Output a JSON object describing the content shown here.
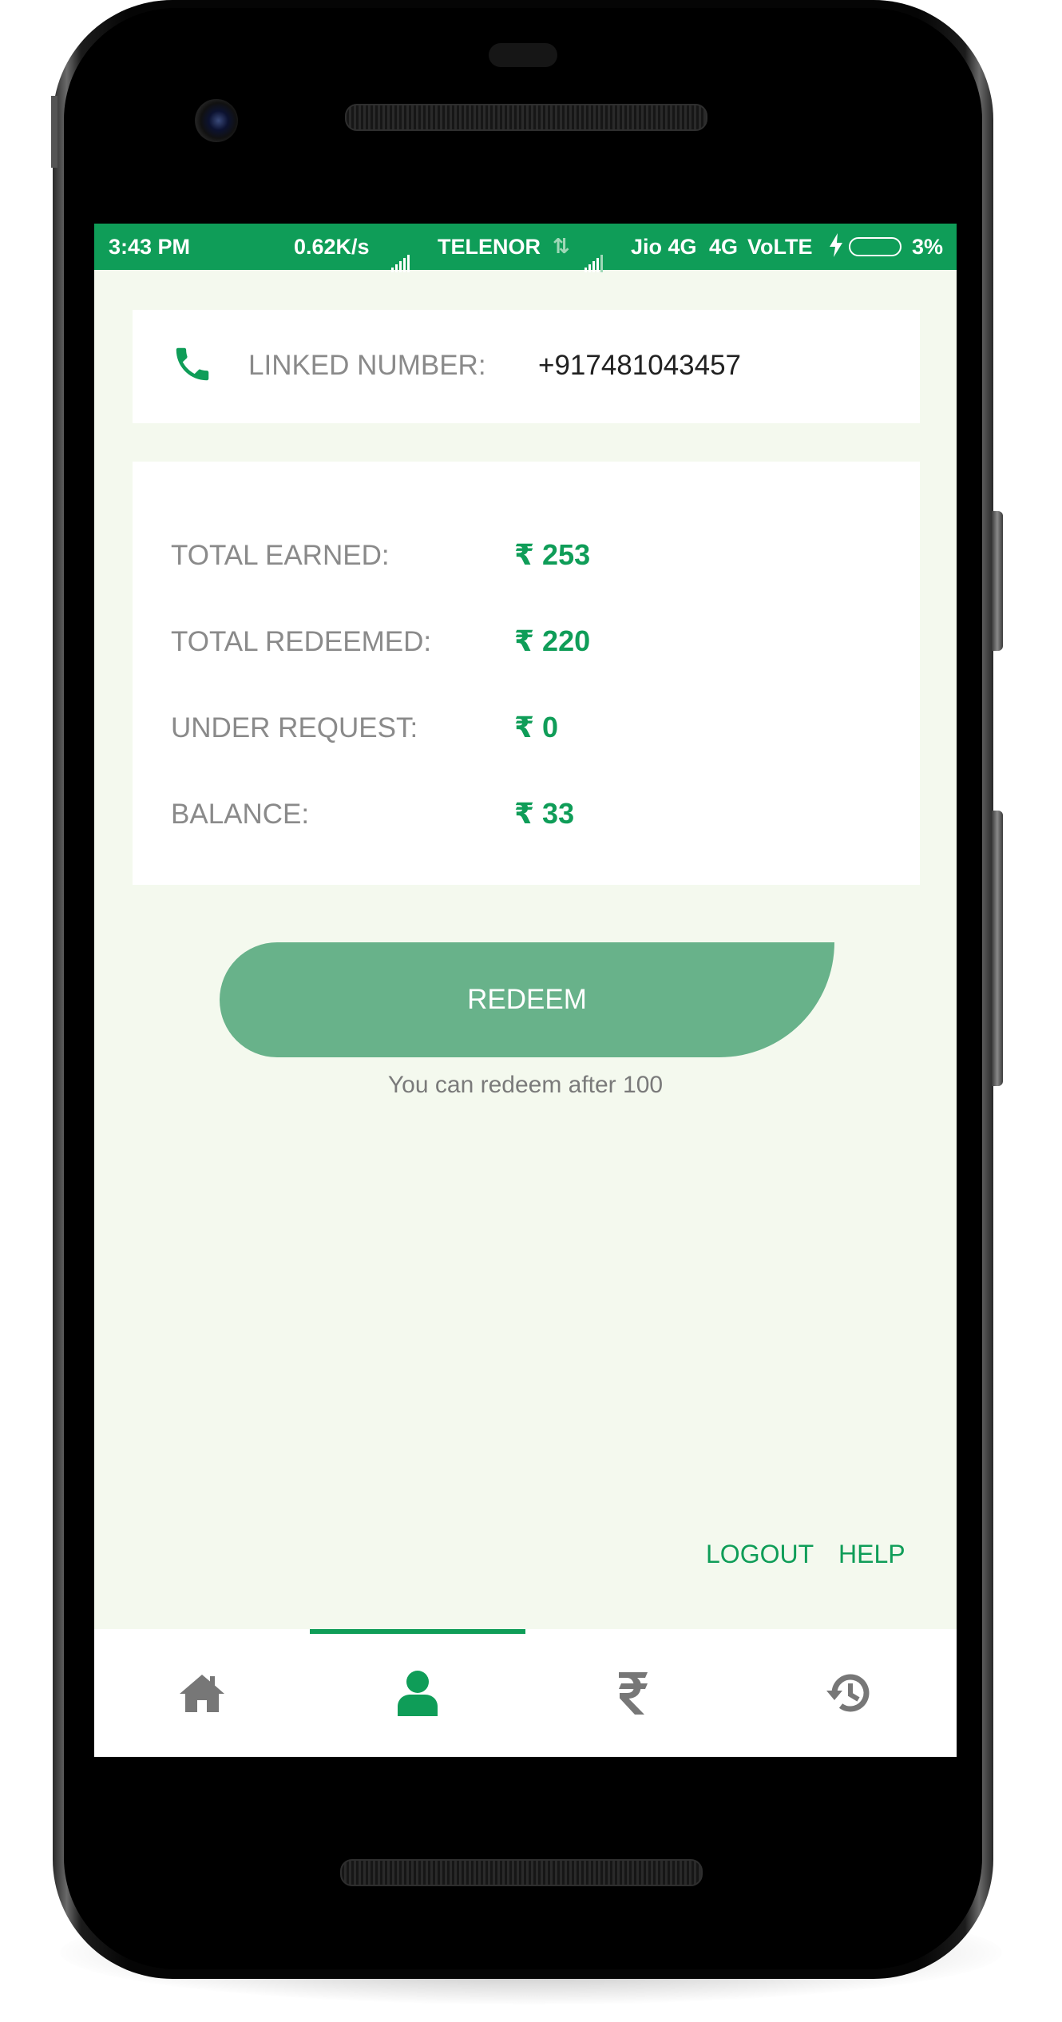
{
  "status_bar": {
    "time": "3:43 PM",
    "speed": "0.62K/s",
    "carrier1": "TELENOR",
    "carrier2": "Jio 4G",
    "network": "4G",
    "volte": "VoLTE",
    "battery": "3%"
  },
  "linked_number": {
    "label": "LINKED NUMBER:",
    "value": "+917481043457",
    "icon": "phone-icon"
  },
  "stats": [
    {
      "label": "TOTAL EARNED:",
      "value": "₹ 253"
    },
    {
      "label": "TOTAL REDEEMED:",
      "value": "₹ 220"
    },
    {
      "label": "UNDER REQUEST:",
      "value": "₹ 0"
    },
    {
      "label": "BALANCE:",
      "value": "₹ 33"
    }
  ],
  "redeem": {
    "button_label": "REDEEM",
    "note": "You can redeem after 100"
  },
  "links": {
    "logout": "LOGOUT",
    "help": "HELP"
  },
  "bottom_nav": {
    "items": [
      {
        "icon": "home-icon",
        "active": false
      },
      {
        "icon": "user-icon",
        "active": true
      },
      {
        "icon": "rupee-icon",
        "active": false
      },
      {
        "icon": "history-icon",
        "active": false
      }
    ]
  },
  "colors": {
    "accent": "#0f9d58",
    "button": "#68b28a",
    "background": "#f4f9ee",
    "inactive_icon": "#777777"
  }
}
